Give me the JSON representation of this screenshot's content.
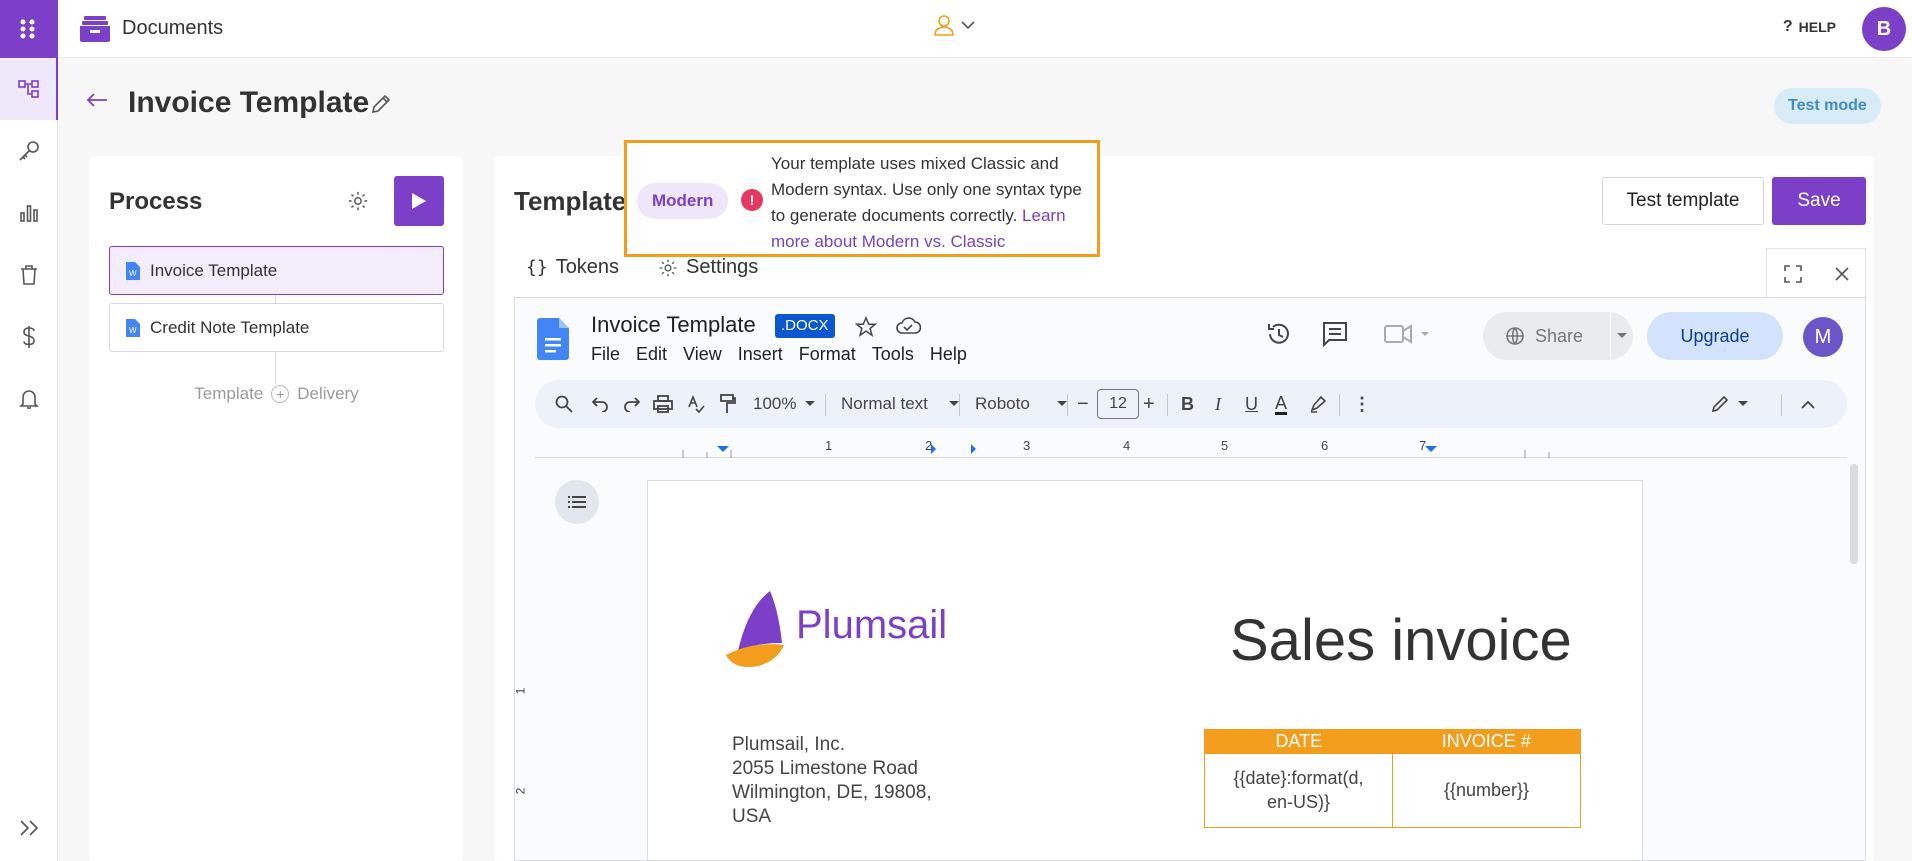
{
  "app": {
    "title": "Documents",
    "help_label": "HELP",
    "user_initial": "B"
  },
  "page": {
    "title": "Invoice Template",
    "test_mode_label": "Test mode"
  },
  "process": {
    "title": "Process",
    "items": [
      {
        "label": "Invoice Template",
        "selected": true
      },
      {
        "label": "Credit Note Template",
        "selected": false
      }
    ],
    "steps": {
      "left": "Template",
      "right": "Delivery"
    }
  },
  "template": {
    "title": "Template",
    "syntax_badge": "Modern",
    "warning": {
      "text": "Your template uses mixed Classic and Modern syntax. Use only one syntax type to generate documents correctly.",
      "link": "Learn more about Modern vs. Classic"
    },
    "test_button": "Test template",
    "save_button": "Save",
    "tabs": [
      {
        "label": "Tokens"
      },
      {
        "label": "Settings"
      }
    ]
  },
  "gdoc": {
    "doc_name": "Invoice Template",
    "badge": ".DOCX",
    "menu": [
      "File",
      "Edit",
      "View",
      "Insert",
      "Format",
      "Tools",
      "Help"
    ],
    "share_label": "Share",
    "upgrade_label": "Upgrade",
    "avatar_initial": "M",
    "toolbar": {
      "zoom": "100%",
      "style": "Normal text",
      "font": "Roboto",
      "font_size": "12"
    },
    "ruler_numbers": [
      "1",
      "2",
      "3",
      "4",
      "5",
      "6",
      "7"
    ],
    "vruler_numbers": [
      "1",
      "2"
    ]
  },
  "document": {
    "logo_text": "Plumsail",
    "heading": "Sales invoice",
    "address": [
      "Plumsail, Inc.",
      "2055 Limestone Road",
      "Wilmington, DE, 19808,",
      "USA"
    ],
    "table": {
      "headers": [
        "DATE",
        "INVOICE #"
      ],
      "cells": [
        "{{date}:format(d, en-US)}",
        "{{number}}"
      ]
    }
  },
  "colors": {
    "brand": "#7b3fc8",
    "accent": "#f29d1c",
    "warning": "#e53963",
    "gdoc_blue": "#0b57d0"
  }
}
